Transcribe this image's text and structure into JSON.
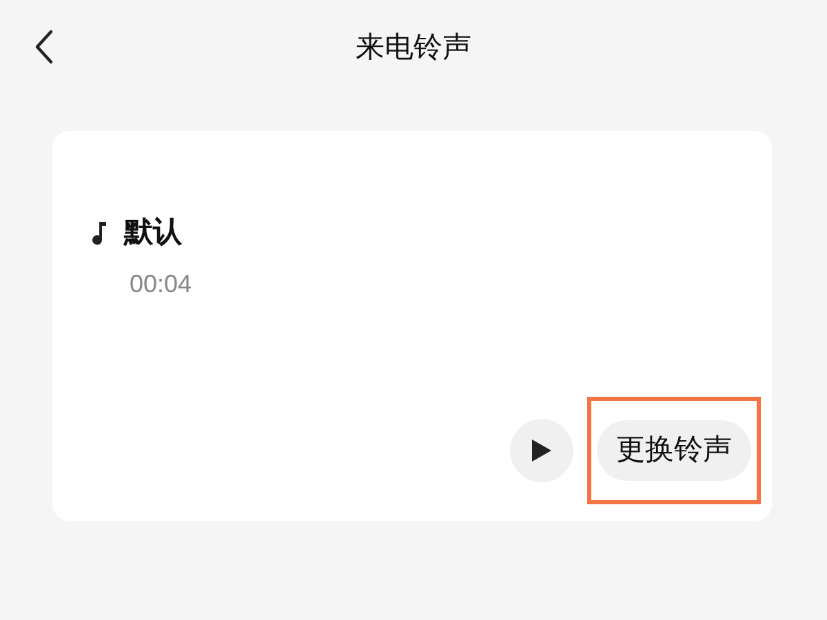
{
  "header": {
    "title": "来电铃声"
  },
  "ringtone": {
    "name": "默认",
    "duration": "00:04"
  },
  "change_button": {
    "label": "更换铃声",
    "highlighted": true
  }
}
